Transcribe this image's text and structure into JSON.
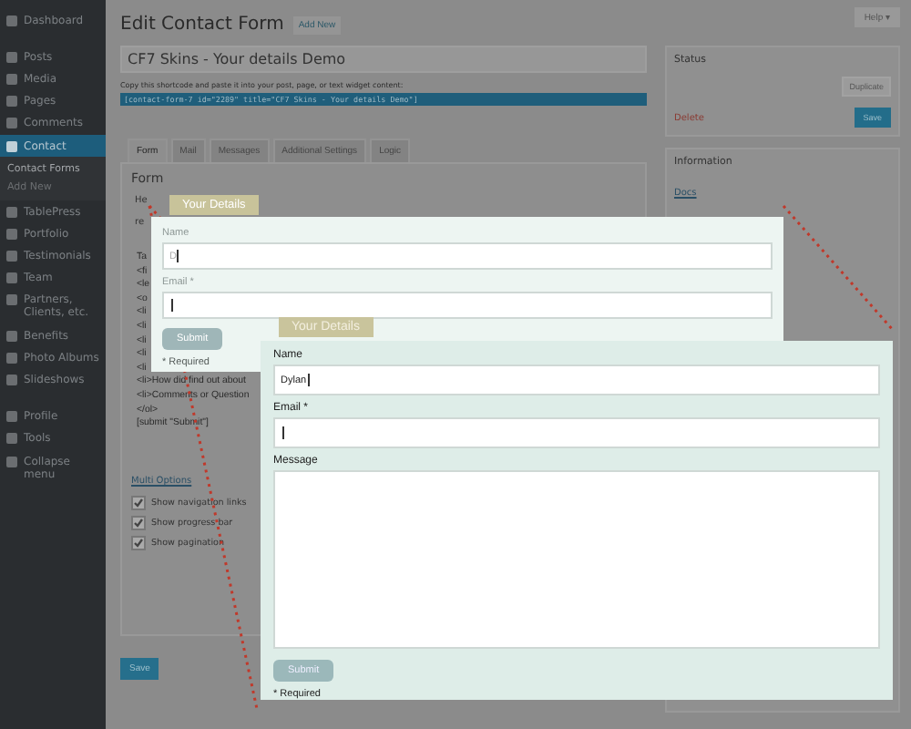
{
  "sidebar": {
    "groups": [
      [
        {
          "label": "Dashboard",
          "selected": false
        }
      ],
      [
        {
          "label": "Posts",
          "selected": false
        },
        {
          "label": "Media",
          "selected": false
        },
        {
          "label": "Pages",
          "selected": false
        },
        {
          "label": "Comments",
          "selected": false
        },
        {
          "label": "Contact",
          "selected": true,
          "children": [
            {
              "label": "Contact Forms",
              "selected": true
            },
            {
              "label": "Add New",
              "selected": false
            }
          ]
        },
        {
          "label": "TablePress",
          "selected": false
        },
        {
          "label": "Portfolio",
          "selected": false
        },
        {
          "label": "Testimonials",
          "selected": false
        },
        {
          "label": "Team",
          "selected": false
        },
        {
          "label": "Partners, Clients, etc.",
          "selected": false
        },
        {
          "label": "Benefits",
          "selected": false
        },
        {
          "label": "Photo Albums",
          "selected": false
        },
        {
          "label": "Slideshows",
          "selected": false
        }
      ],
      [
        {
          "label": "Profile",
          "selected": false
        },
        {
          "label": "Tools",
          "selected": false
        },
        {
          "label": "Collapse menu",
          "selected": false
        }
      ]
    ]
  },
  "help_button": "Help ▾",
  "page_title": "Edit Contact Form",
  "add_new": "Add New",
  "form_title": "CF7 Skins - Your details Demo",
  "shortcode_hint": "Copy this shortcode and paste it into your post, page, or text widget content:",
  "shortcode": "[contact-form-7 id=\"2289\" title=\"CF7 Skins - Your details Demo\"]",
  "tabs": [
    {
      "label": "Form",
      "selected": true
    },
    {
      "label": "Mail",
      "selected": false
    },
    {
      "label": "Messages",
      "selected": false
    },
    {
      "label": "Additional Settings",
      "selected": false
    },
    {
      "label": "Logic",
      "selected": false
    }
  ],
  "form_panel": {
    "heading": "Form",
    "fields": [
      "He",
      "re"
    ],
    "code_lines": [
      "Ta",
      "<fi",
      "<le",
      "<o",
      "<li",
      "<li",
      "<li",
      "<li",
      "<li",
      "<li>How did find out about",
      "<li>Comments or Question",
      "</ol>",
      "[submit \"Submit\"]"
    ],
    "multi_options": "Multi Options",
    "options": [
      {
        "label": "Show navigation links",
        "checked": true
      },
      {
        "label": "Show progress bar",
        "checked": true
      },
      {
        "label": "Show pagination",
        "checked": true
      }
    ]
  },
  "save": "Save",
  "status_box": {
    "title": "Status",
    "duplicate": "Duplicate",
    "delete": "Delete",
    "save": "Save"
  },
  "information_box": {
    "title": "Information",
    "link": "Docs"
  },
  "previews": [
    {
      "legend": "Your Details",
      "fields": [
        {
          "label": "Name",
          "value": "D",
          "kind": "text"
        },
        {
          "label": "Email *",
          "kind": "text"
        }
      ],
      "submit": "Submit",
      "required": "* Required"
    },
    {
      "legend": "Your Details",
      "fields": [
        {
          "label": "Name",
          "value": "Dylan",
          "kind": "text"
        },
        {
          "label": "Email *",
          "kind": "text"
        },
        {
          "label": "Message",
          "kind": "textarea"
        }
      ],
      "submit": "Submit",
      "required": "* Required"
    }
  ]
}
